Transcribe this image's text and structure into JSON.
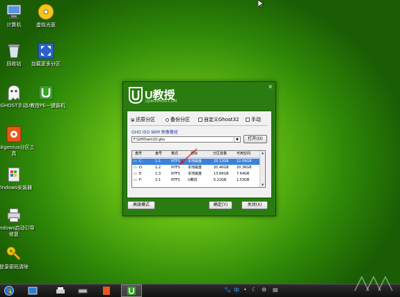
{
  "desktop": {
    "icons": [
      {
        "label": "计算机"
      },
      {
        "label": "虚拟光驱"
      },
      {
        "label": "回收站"
      },
      {
        "label": "加载更多分区"
      },
      {
        "label": "GHOST手动"
      },
      {
        "label": "U教授PE一键装机"
      },
      {
        "label": "Diskgenius分区工具"
      },
      {
        "label": "Windows安装器"
      },
      {
        "label": "Windows启动引导修复"
      },
      {
        "label": "登录密码清除"
      }
    ]
  },
  "window": {
    "logo_text": "U教授",
    "logo_sub": "UJIAOSHOU.COM",
    "radios": {
      "restore": "还原分区",
      "backup": "备份分区",
      "custom": "自定义Ghost32",
      "manual": "手动"
    },
    "path_label": "GHO ISO WIM 映像路径",
    "path_value": "F:\\GHO\\win10.gho",
    "open_button": "打开(O)",
    "table": {
      "headers": [
        "盘符",
        "盘号",
        "格式",
        "卷标",
        "分区容量",
        "可用空间"
      ],
      "rows": [
        {
          "drive": "C:",
          "num": "1:1",
          "fmt": "NTFS",
          "label": "本地磁盘",
          "size": "25.13GB",
          "free": "22.09GB"
        },
        {
          "drive": "D:",
          "num": "1:2",
          "fmt": "NTFS",
          "label": "本地磁盘",
          "size": "20.46GB",
          "free": "20.36GB"
        },
        {
          "drive": "E:",
          "num": "1:3",
          "fmt": "NTFS",
          "label": "本地磁盘",
          "size": "13.66GB",
          "free": "7.64GB"
        },
        {
          "drive": "F:",
          "num": "2:1",
          "fmt": "NTFS",
          "label": "U教授",
          "size": "5.22GB",
          "free": "1.53GB"
        }
      ]
    },
    "advanced_button": "高级模式",
    "ok_button": "确定(Y)",
    "close_button": "关闭(X)"
  },
  "taskbar": {
    "tray_text": "中"
  },
  "colors": {
    "window_bg": "#2a7c11",
    "selection": "#3c82d9",
    "arrow": "#e02020"
  }
}
